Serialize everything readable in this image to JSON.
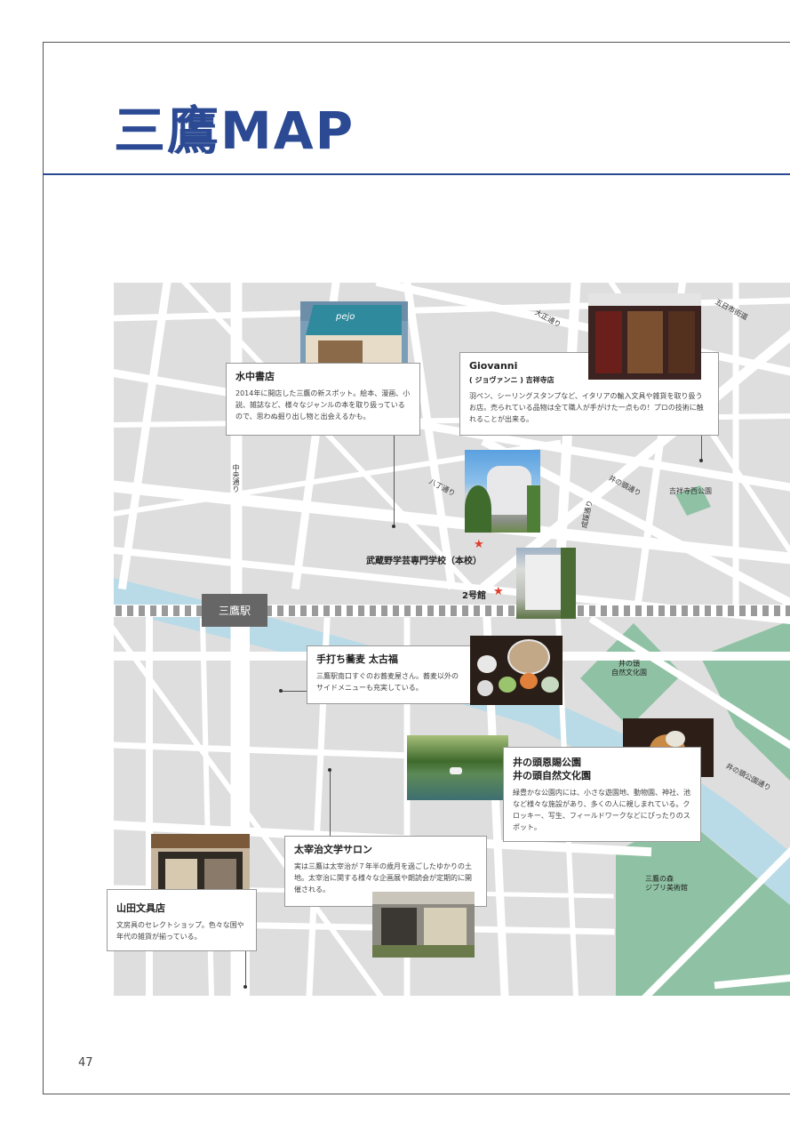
{
  "page": {
    "title": "三鷹MAP",
    "page_number": "47"
  },
  "colors": {
    "accent": "#2b4a93",
    "map_bg": "#dedede",
    "road": "#ffffff",
    "water": "#b9dbe8",
    "park": "#8fc2a4",
    "rail": "#9a9a9a",
    "star": "#e03a2b"
  },
  "station": {
    "name": "三鷹駅"
  },
  "roads": {
    "taisho": "大正通り",
    "itsukaichi": "五日市街道",
    "chuo": "中央通り",
    "hatcho": "八丁通り",
    "seikei": "成蹊通り",
    "inokashira": "井の頭通り",
    "inokashira_park": "井の頭公園通り"
  },
  "places": {
    "kichijoji_nishi_park": "吉祥寺西公園",
    "musashino_school": "武蔵野学芸専門学校（本校）",
    "building2": "2号館",
    "zoo": {
      "line1": "井の頭",
      "line2": "自然文化園"
    },
    "ghibli": {
      "line1": "三鷹の森",
      "line2": "ジブリ美術館"
    }
  },
  "cards": {
    "mizunaka": {
      "title": "水中書店",
      "body": "2014年に開店した三鷹の新スポット。絵本、漫画、小説、雑誌など、様々なジャンルの本を取り扱っているので、思わぬ掘り出し物と出会えるかも。"
    },
    "giovanni": {
      "title": "Giovanni",
      "subtitle": "( ジョヴァンニ ) 吉祥寺店",
      "body": "羽ペン、シーリングスタンプなど、イタリアの輸入文具や雑貨を取り扱うお店。売られている品物は全て職人が手がけた一点もの！プロの技術に触れることが出来る。"
    },
    "taikofuku": {
      "title": "手打ち蕎麦 太古福",
      "body": "三鷹駅南口すぐのお蕎麦屋さん。蕎麦以外のサイドメニューも充実している。"
    },
    "inokashira": {
      "title_line1": "井の頭恩賜公園",
      "title_line2": "井の頭自然文化園",
      "body": "緑豊かな公園内には、小さな遊園地、動物園、神社、池など様々な施設があり、多くの人に親しまれている。クロッキー、写生、フィールドワークなどにぴったりのスポット。"
    },
    "dazai": {
      "title": "太宰治文学サロン",
      "body": "実は三鷹は太宰治が７年半の歳月を過ごしたゆかりの土地。太宰治に関する様々な企画展や朗読会が定期的に開催される。"
    },
    "yamada": {
      "title": "山田文具店",
      "body": "文房具のセレクトショップ。色々な国や年代の雑貨が揃っている。"
    }
  },
  "photos": {
    "mizunaka_sign": "pejo"
  }
}
